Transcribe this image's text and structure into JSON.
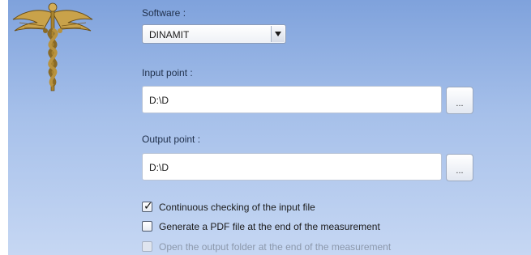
{
  "logo": {
    "icon": "caduceus-icon"
  },
  "software": {
    "label": "Software :",
    "selected": "DINAMIT"
  },
  "input_point": {
    "label": "Input point :",
    "value": "D:\\D",
    "browse_label": "..."
  },
  "output_point": {
    "label": "Output point :",
    "value": "D:\\D",
    "browse_label": "..."
  },
  "options": [
    {
      "label": "Continuous checking of the input file",
      "checked": true,
      "enabled": true
    },
    {
      "label": "Generate a PDF file at the end of the measurement",
      "checked": false,
      "enabled": true
    },
    {
      "label": "Open the output folder at the end of the measurement",
      "checked": false,
      "enabled": false
    }
  ],
  "colors": {
    "background_top": "#7fa2dc",
    "background_bottom": "#c6d7f3",
    "disabled_text": "#8c98ab"
  }
}
